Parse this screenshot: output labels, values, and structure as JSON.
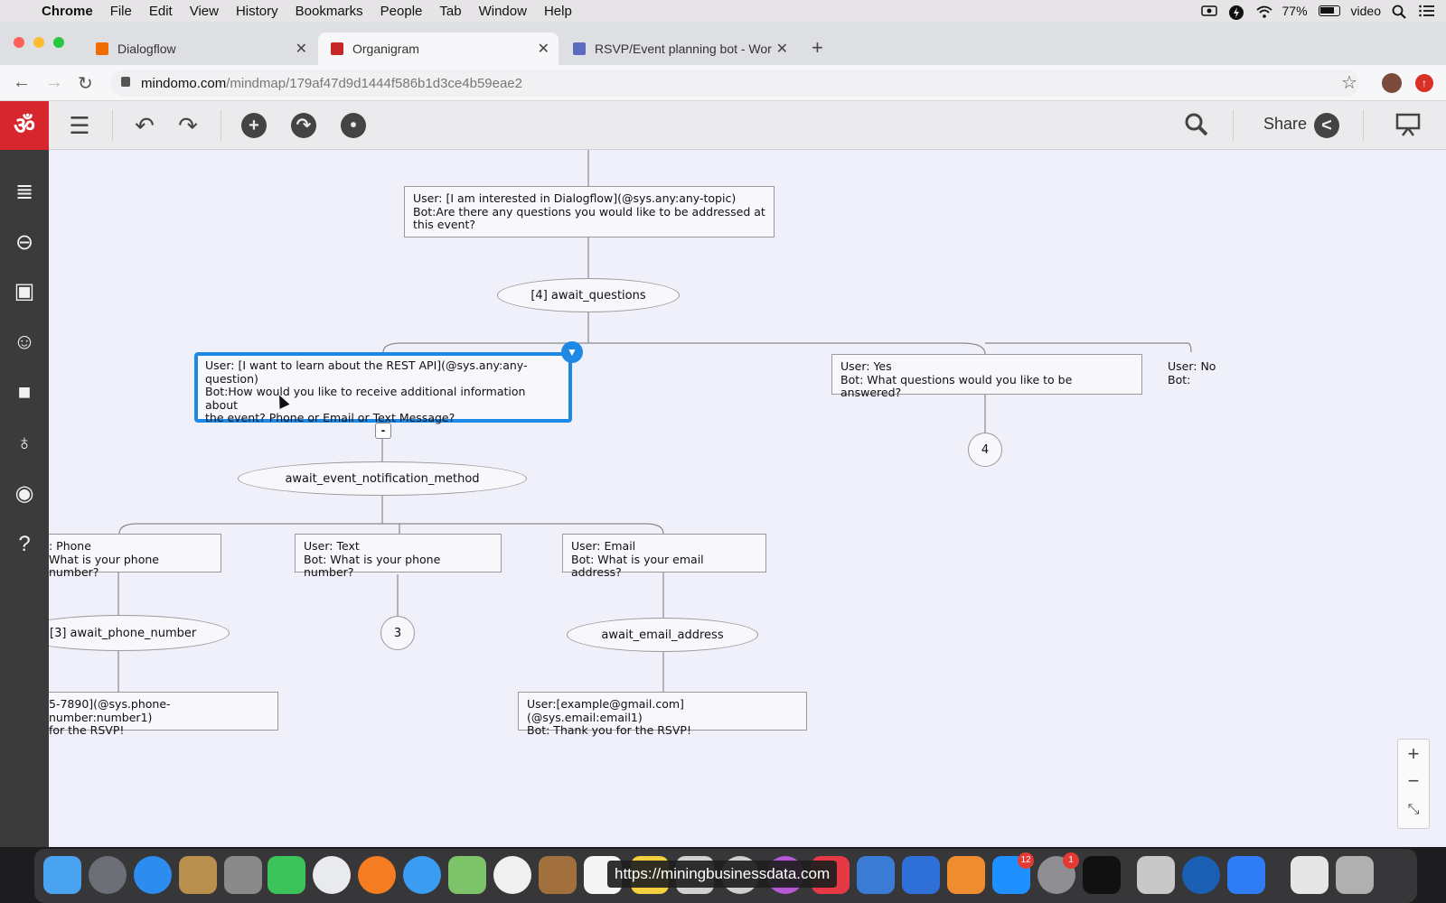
{
  "menubar": {
    "app": "Chrome",
    "items": [
      "File",
      "Edit",
      "View",
      "History",
      "Bookmarks",
      "People",
      "Tab",
      "Window",
      "Help"
    ],
    "battery": "77%",
    "user": "video"
  },
  "tabs": [
    {
      "title": "Dialogflow",
      "favicon_color": "#ef6c00"
    },
    {
      "title": "Organigram",
      "favicon_color": "#c62828"
    },
    {
      "title": "RSVP/Event planning bot - Work",
      "favicon_color": "#5c6bc0"
    }
  ],
  "address": {
    "domain": "mindomo.com",
    "path": "/mindmap/179af47d9d1444f586b1d3ce4b59eae2"
  },
  "toolbar": {
    "share_label": "Share"
  },
  "mindmap": {
    "root_node": "User: [I am interested in Dialogflow](@sys.any:any-topic)\nBot:Are there any questions you would like to be addressed at\nthis event?",
    "await_questions": "[4] await_questions",
    "selected_node": "User: [I want to learn about the REST API](@sys.any:any-\nquestion)\nBot:How would you like to receive additional information about\nthe event? Phone or Email or Text Message?",
    "yes_node": "User: Yes\nBot: What questions would you like to be answered?",
    "no_node": "User: No\nBot:",
    "yes_ref": "4",
    "await_notification": "await_event_notification_method",
    "phone_node": ": Phone\nWhat is your phone number?",
    "text_node": "User: Text\nBot: What is your phone number?",
    "email_node": "User: Email\nBot: What is your email address?",
    "await_phone": "[3] await_phone_number",
    "text_ref": "3",
    "await_email": "await_email_address",
    "phone_confirm": "5-7890](@sys.phone-number:number1)\n for the RSVP!",
    "email_confirm": "User:[example@gmail.com](@sys.email:email1)\nBot: Thank you for the RSVP!",
    "collapse_label": "-"
  },
  "zoom": {
    "plus": "+",
    "minus": "−"
  },
  "dock": {
    "tooltip": "https://miningbusinessdata.com",
    "appstore_badge": "12",
    "prefs_badge": "1"
  }
}
